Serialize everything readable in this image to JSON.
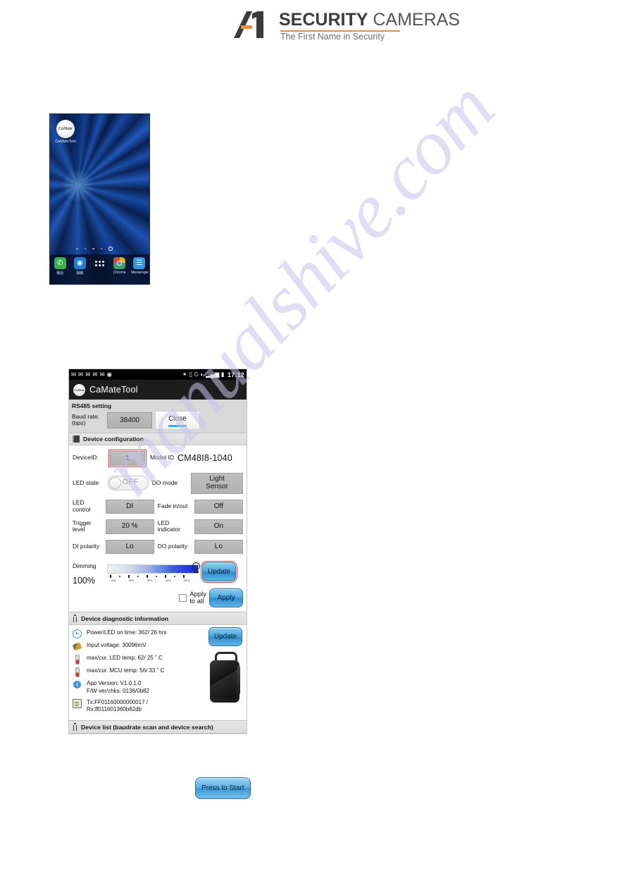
{
  "brand": {
    "name_bold": "SECURITY",
    "name_light": " CAMERAS",
    "tagline": "The First Name in Security",
    "accent_color": "#e8913c"
  },
  "watermark": {
    "text": "manualshive.com",
    "color": "#c9c2ec"
  },
  "home_screen": {
    "app_icon_label": "CaMateTool",
    "app_icon_text": "CaMate",
    "dock": [
      {
        "name": "phone",
        "label": "電話",
        "glyph": "✆"
      },
      {
        "name": "camera",
        "label": "相機",
        "glyph": "◉"
      },
      {
        "name": "apps",
        "label": "",
        "glyph": ""
      },
      {
        "name": "chrome",
        "label": "Chrome",
        "glyph": ""
      },
      {
        "name": "messenger",
        "label": "Messenger",
        "glyph": "≡"
      }
    ]
  },
  "app": {
    "status_bar": {
      "left_icons": [
        "✉",
        "✉",
        "✉",
        "✉",
        "✉",
        "◉"
      ],
      "bluetooth": "✶",
      "vibrate": "▯",
      "alarm": "⏰",
      "wifi": "◠",
      "signal": "▂▄▆",
      "battery": "▮",
      "clock": "17:12"
    },
    "action_bar": {
      "logo_text": "CaMate",
      "title": "CaMateTool"
    },
    "rs485": {
      "section_title": "RS485 setting",
      "baud_label_line1": "Baud rate:",
      "baud_label_line2": "(bps)",
      "baud_value": "38400",
      "close_label": "Close"
    },
    "device_configuration": {
      "section_title": "Device configuration",
      "device_id_label": "DeviceID:",
      "device_id_value": "1",
      "model_id_label": "Model ID",
      "model_id_value": "CM48I8-1040",
      "led_state_label": "LED state",
      "led_state_value": "OFF",
      "do_mode_label": "DO mode",
      "do_mode_value_line1": "Light",
      "do_mode_value_line2": "Sensor",
      "led_control_label_line1": "LED",
      "led_control_label_line2": "control",
      "led_control_value": "DI",
      "fade_label": "Fade in/out",
      "fade_value": "Off",
      "trigger_label_line1": "Trigger",
      "trigger_label_line2": "level",
      "trigger_value": "20 %",
      "led_indicator_label_line1": "LED",
      "led_indicator_label_line2": "indicator",
      "led_indicator_value": "On",
      "di_polarity_label": "DI polarity",
      "di_polarity_value": "Lo",
      "do_polarity_label": "DO polarity",
      "do_polarity_value": "Lo",
      "dimming_label": "Dimming",
      "dimming_value": "100%",
      "slider_ticks": [
        "20%",
        "40%",
        "60%",
        "80%",
        "100%"
      ],
      "update_label": "Update",
      "apply_to_all_label_line1": "Apply",
      "apply_to_all_label_line2": "to all",
      "apply_label": "Apply"
    },
    "diagnostics": {
      "section_title": "Device diagnostic information",
      "update_label": "Update",
      "rows": [
        {
          "icon": "clock-icon",
          "text": "Power/LED on time: 362/ 26 hrs"
        },
        {
          "icon": "voltage-icon",
          "text": "Input voltage: 30096mV"
        },
        {
          "icon": "thermometer-icon",
          "text": "max/cur. LED temp: 62/ 25 ˚ C"
        },
        {
          "icon": "thermometer-icon",
          "text": "max/cur. MCU temp: 56/ 33 ˚ C"
        }
      ],
      "version_line1": "App Version: V1.0.1.0",
      "version_line2": "F/W ver/chks: 0136/0b82",
      "log_line1": "Tx:FF01160000000017 /",
      "log_line2": "Rx:ff011601360b82db"
    },
    "device_list": {
      "section_title": "Device list (baudrate scan and device search)"
    },
    "press_to_start_label": "Press to Start"
  }
}
